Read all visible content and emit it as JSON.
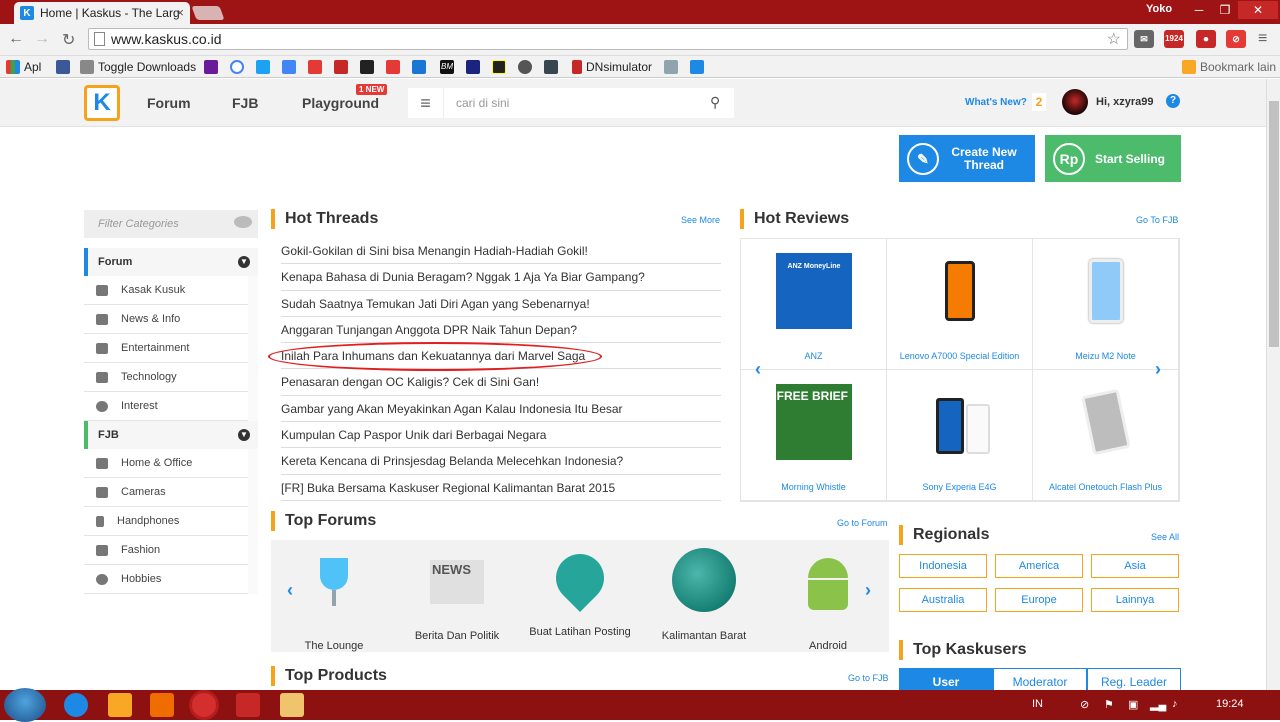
{
  "browser": {
    "tab_title": "Home | Kaskus - The Larg",
    "tab_icon": "K",
    "user": "Yoko",
    "url": "www.kaskus.co.id",
    "ext_badge": "1924"
  },
  "bookmarks": {
    "apps": "Apl",
    "toggle": "Toggle Downloads",
    "bm": "BM",
    "dnsim": "DNsimulator",
    "other": "Bookmark lain"
  },
  "header": {
    "logo": "K",
    "nav": [
      "Forum",
      "FJB",
      "Playground"
    ],
    "new_badge": "1 NEW",
    "search_placeholder": "cari di sini",
    "whats_new": "What's New?",
    "notif_count": "2",
    "greeting": "Hi, xzyra99",
    "help": "?"
  },
  "actions": {
    "create_thread": "Create New Thread",
    "start_selling": "Start Selling",
    "sell_icon": "Rp"
  },
  "sidebar": {
    "filter_placeholder": "Filter Categories",
    "forum_label": "Forum",
    "forum_items": [
      "Kasak Kusuk",
      "News & Info",
      "Entertainment",
      "Technology",
      "Interest"
    ],
    "fjb_label": "FJB",
    "fjb_items": [
      "Home & Office",
      "Cameras",
      "Handphones",
      "Fashion",
      "Hobbies"
    ]
  },
  "hot_threads": {
    "title": "Hot Threads",
    "link": "See More",
    "items": [
      "Gokil-Gokilan di Sini bisa Menangin Hadiah-Hadiah Gokil!",
      "Kenapa Bahasa di Dunia Beragam? Nggak 1 Aja Ya Biar Gampang?",
      "Sudah Saatnya Temukan Jati Diri Agan yang Sebenarnya!",
      "Anggaran Tunjangan Anggota DPR Naik Tahun Depan?",
      "Inilah Para Inhumans dan Kekuatannya dari Marvel Saga",
      "Penasaran dengan OC Kaligis? Cek di Sini Gan!",
      "Gambar yang Akan Meyakinkan Agan Kalau Indonesia Itu Besar",
      "Kumpulan Cap Paspor Unik dari Berbagai Negara",
      "Kereta Kencana di Prinsjesdag Belanda Melecehkan Indonesia?",
      "[FR] Buka Bersama Kaskuser Regional Kalimantan Barat 2015"
    ]
  },
  "hot_reviews": {
    "title": "Hot Reviews",
    "link": "Go To FJB",
    "items": [
      "ANZ",
      "Lenovo A7000 Special Edition",
      "Meizu M2 Note",
      "Morning Whistle",
      "Sony Experia E4G",
      "Alcatel Onetouch Flash Plus"
    ],
    "anz_promo": "ANZ MoneyLine",
    "free_brief": "FREE BRIEF"
  },
  "top_forums": {
    "title": "Top Forums",
    "link": "Go to Forum",
    "items": [
      "The Lounge",
      "Berita Dan Politik",
      "Buat Latihan Posting",
      "Kalimantan Barat",
      "Android"
    ],
    "news_icon_text": "NEWS"
  },
  "regionals": {
    "title": "Regionals",
    "link": "See All",
    "items": [
      "Indonesia",
      "America",
      "Asia",
      "Australia",
      "Europe",
      "Lainnya"
    ]
  },
  "top_products": {
    "title": "Top Products",
    "link": "Go to FJB"
  },
  "top_kaskusers": {
    "title": "Top Kaskusers",
    "tabs": [
      "User",
      "Moderator",
      "Reg. Leader"
    ]
  },
  "taskbar": {
    "lang": "IN",
    "time": "19:24"
  },
  "colors": {
    "accent_blue": "#1e88e5",
    "accent_orange": "#f7a21b",
    "accent_green": "#4cbb6c",
    "browser_red": "#9e1414",
    "highlight_circle": "#e31e1e"
  }
}
